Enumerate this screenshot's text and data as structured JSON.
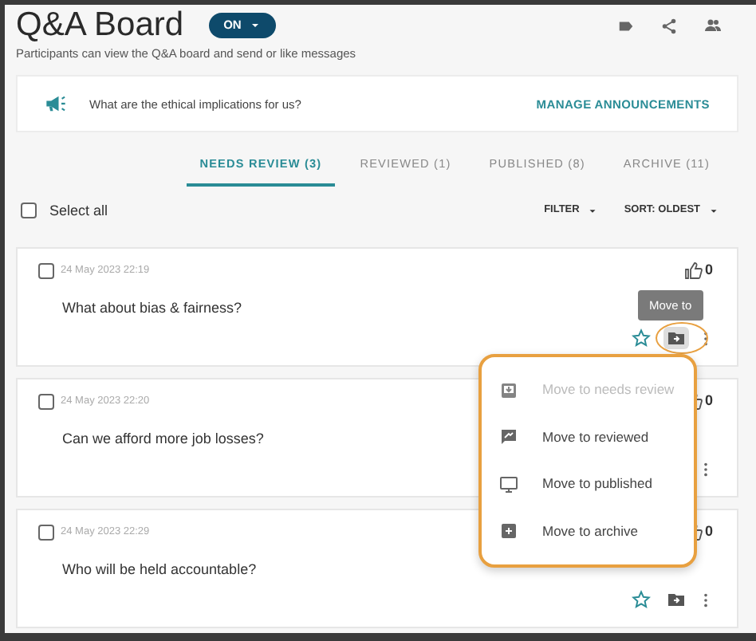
{
  "header": {
    "title": "Q&A Board",
    "status_toggle": {
      "label": "ON",
      "on": true
    },
    "subtitle": "Participants can view the Q&A board and send or like messages"
  },
  "announcement": {
    "text": "What are the ethical implications for us?",
    "action": "MANAGE ANNOUNCEMENTS"
  },
  "tabs": [
    {
      "label": "NEEDS REVIEW (3)",
      "selected": true
    },
    {
      "label": "REVIEWED (1)",
      "selected": false
    },
    {
      "label": "PUBLISHED (8)",
      "selected": false
    },
    {
      "label": "ARCHIVE (11)",
      "selected": false
    }
  ],
  "toolbar": {
    "select_all": {
      "label": "Select all",
      "checked": false
    },
    "filter": "FILTER",
    "sort": "SORT: OLDEST"
  },
  "questions": [
    {
      "date": "24 May 2023 22:19",
      "text": "What about bias & fairness?",
      "checked": false,
      "likes": "0",
      "actions": [
        {
          "kind": "star"
        },
        {
          "kind": "move",
          "active": true
        },
        {
          "kind": "more"
        }
      ]
    },
    {
      "date": "24 May 2023 22:20",
      "text": "Can we afford more job losses?",
      "checked": false,
      "likes": "0",
      "actions": [
        {
          "kind": "more"
        }
      ]
    },
    {
      "date": "24 May 2023 22:29",
      "text": "Who will be held accountable?",
      "checked": false,
      "likes": "0",
      "actions": [
        {
          "kind": "star"
        },
        {
          "kind": "move",
          "active": false
        },
        {
          "kind": "more"
        }
      ]
    }
  ],
  "tooltip": "Move to",
  "move_menu": [
    {
      "kind": "needs_review",
      "label": "Move to needs review",
      "disabled": true
    },
    {
      "kind": "reviewed",
      "label": "Move to reviewed",
      "disabled": false
    },
    {
      "kind": "published",
      "label": "Move to published",
      "disabled": false
    },
    {
      "kind": "archive",
      "label": "Move to archive",
      "disabled": false
    }
  ]
}
